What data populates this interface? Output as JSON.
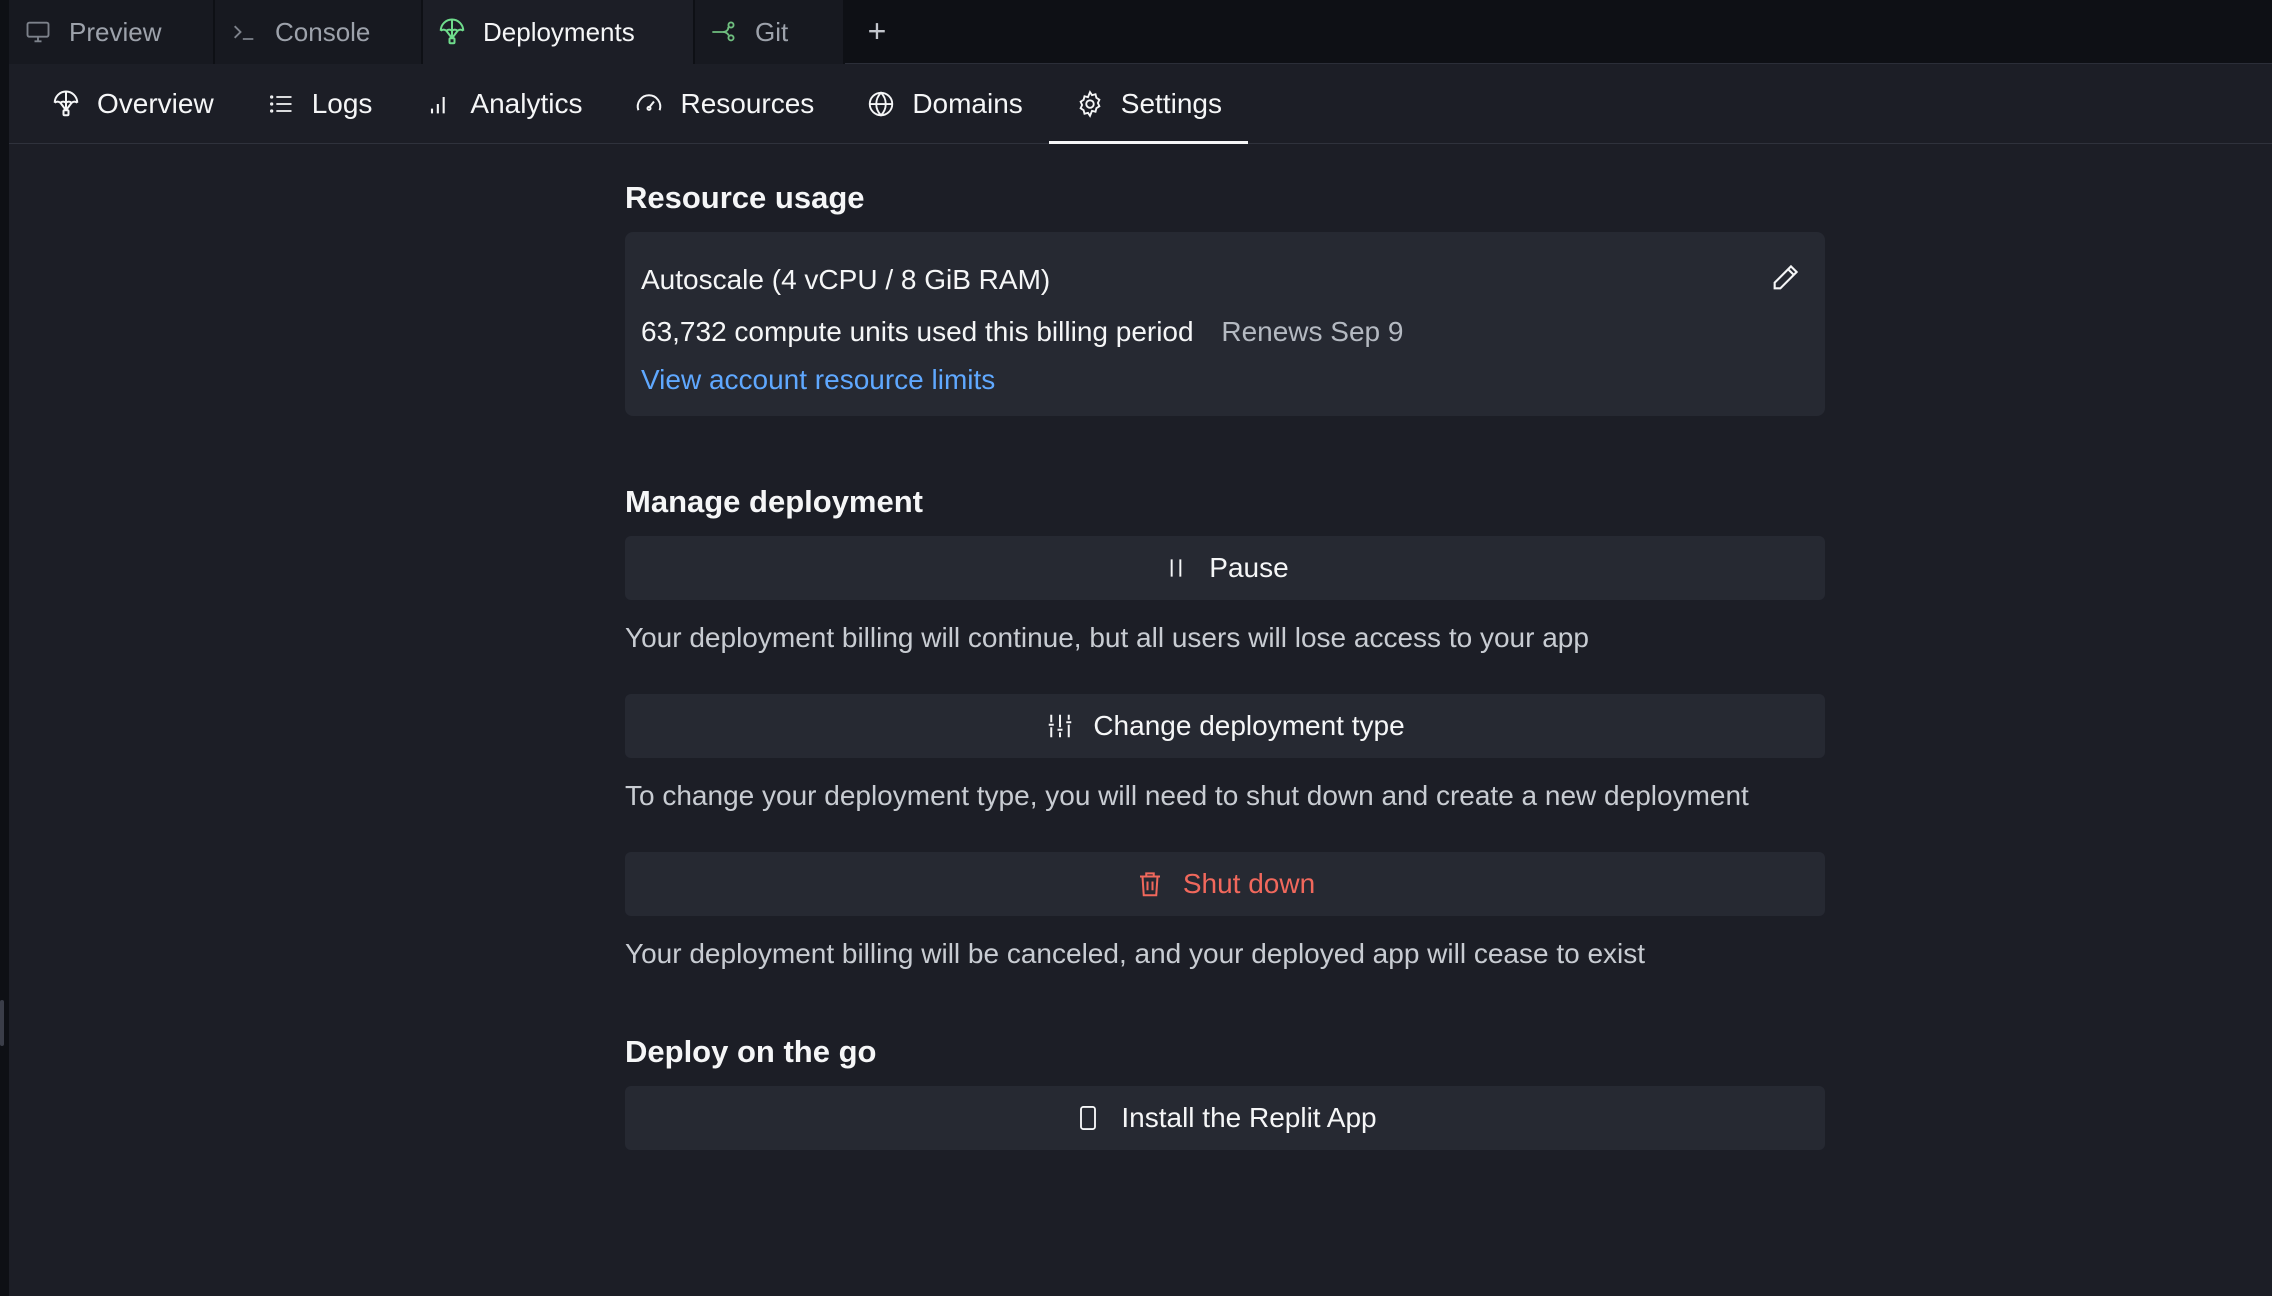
{
  "tabs": [
    {
      "label": "Preview",
      "icon": "monitor-icon"
    },
    {
      "label": "Console",
      "icon": "terminal-icon"
    },
    {
      "label": "Deployments",
      "icon": "deployments-icon",
      "active": true
    },
    {
      "label": "Git",
      "icon": "git-branch-icon"
    }
  ],
  "add_tab_label": "+",
  "subnav": [
    {
      "label": "Overview",
      "icon": "deployments-icon"
    },
    {
      "label": "Logs",
      "icon": "list-icon"
    },
    {
      "label": "Analytics",
      "icon": "bar-chart-icon"
    },
    {
      "label": "Resources",
      "icon": "gauge-icon"
    },
    {
      "label": "Domains",
      "icon": "globe-icon"
    },
    {
      "label": "Settings",
      "icon": "gear-icon",
      "active": true
    }
  ],
  "resource_usage": {
    "title": "Resource usage",
    "plan": "Autoscale (4 vCPU / 8 GiB RAM)",
    "usage": "63,732 compute units used this billing period",
    "renews": "Renews Sep 9",
    "link": "View account resource limits"
  },
  "manage": {
    "title": "Manage deployment",
    "pause_label": "Pause",
    "pause_desc": "Your deployment billing will continue, but all users will lose access to your app",
    "change_label": "Change deployment type",
    "change_desc": "To change your deployment type, you will need to shut down and create a new deployment",
    "shutdown_label": "Shut down",
    "shutdown_desc": "Your deployment billing will be canceled, and your deployed app will cease to exist"
  },
  "deploy_go": {
    "title": "Deploy on the go",
    "install_label": "Install the Replit App"
  },
  "colors": {
    "background": "#1c1e26",
    "tabbar": "#0e1015",
    "card": "#262932",
    "link": "#5fa8ff",
    "danger": "#f1685c",
    "deploy_accent": "#6fdc8c"
  }
}
